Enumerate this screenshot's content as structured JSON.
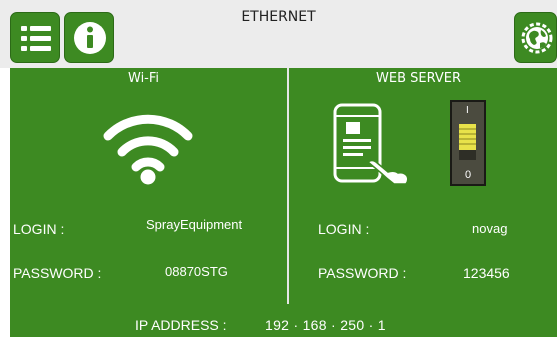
{
  "window": {
    "title": "ETHERNET"
  },
  "toolbar": {
    "menu_icon": "list-icon",
    "info_icon": "info-icon",
    "globe_icon": "globe-settings-icon"
  },
  "wifi": {
    "header": "Wi-Fi",
    "icon": "wifi-icon",
    "login_label": "LOGIN :",
    "login_value": "SprayEquipment",
    "password_label": "PASSWORD :",
    "password_value": "08870STG"
  },
  "webserver": {
    "header": "WEB SERVER",
    "device_icon": "phone-touch-icon",
    "switch": {
      "top_label": "I",
      "bottom_label": "0",
      "state": "on"
    },
    "login_label": "LOGIN :",
    "login_value": "novag",
    "password_label": "PASSWORD :",
    "password_value": "123456"
  },
  "network": {
    "ip_label": "IP ADDRESS :",
    "ip_value": "192 · 168 · 250 ·  1"
  },
  "colors": {
    "panel_green": "#3d8a22",
    "topbar_gray": "#ececec",
    "switch_yellow": "#e8e24a"
  }
}
